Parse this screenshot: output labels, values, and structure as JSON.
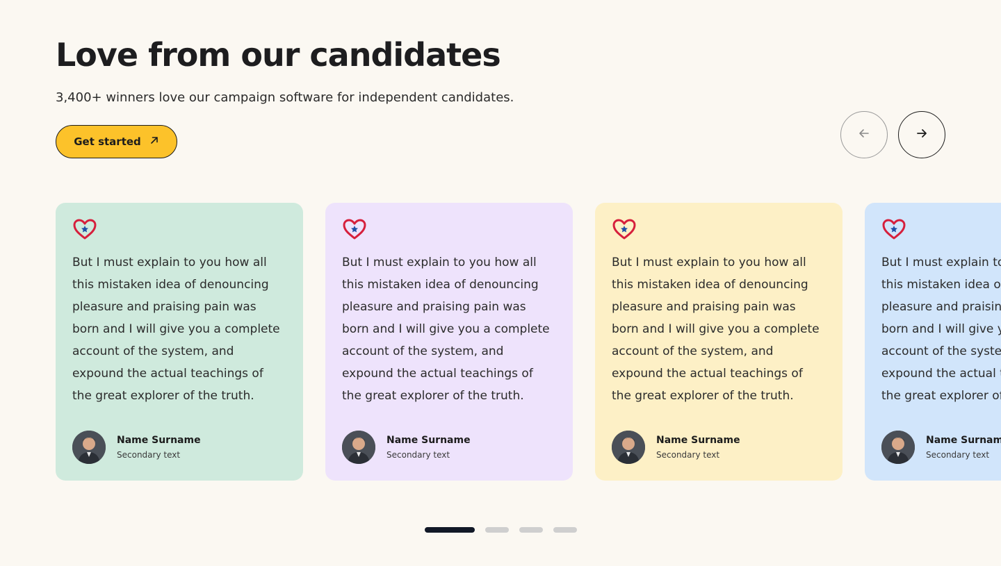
{
  "header": {
    "title": "Love from our candidates",
    "subtitle": "3,400+ winners love our campaign software for independent candidates.",
    "cta_label": "Get started"
  },
  "nav": {
    "prev_icon": "arrow-left-icon",
    "next_icon": "arrow-right-icon"
  },
  "colors": {
    "background": "#fbf8f2",
    "cta": "#fcc22a",
    "card_green": "#cfeadd",
    "card_purple": "#eee3fc",
    "card_yellow": "#fdf0c6",
    "card_blue": "#d1e5fb",
    "heart": "#d61f3c",
    "star": "#1e4fa8"
  },
  "testimonials": [
    {
      "quote": "But I must explain to you how all this mistaken idea of denouncing pleasure and praising pain was born and I will give you a complete account of the system, and expound the actual teachings of the great explorer of the truth.",
      "name": "Name Surname",
      "secondary": "Secondary text"
    },
    {
      "quote": "But I must explain to you how all this mistaken idea of denouncing pleasure and praising pain was born and I will give you a complete account of the system, and expound the actual teachings of the great explorer of the truth.",
      "name": "Name Surname",
      "secondary": "Secondary text"
    },
    {
      "quote": "But I must explain to you how all this mistaken idea of denouncing pleasure and praising pain was born and I will give you a complete account of the system, and expound the actual teachings of the great explorer of the truth.",
      "name": "Name Surname",
      "secondary": "Secondary text"
    },
    {
      "quote": "But I must explain to you how all this mistaken idea of denouncing pleasure and praising pain was born and I will give you a complete account of the system, and expound the actual teachings of the great explorer of the truth.",
      "name": "Name Surname",
      "secondary": "Secondary text"
    }
  ],
  "pagination": {
    "count": 4,
    "active_index": 0
  }
}
